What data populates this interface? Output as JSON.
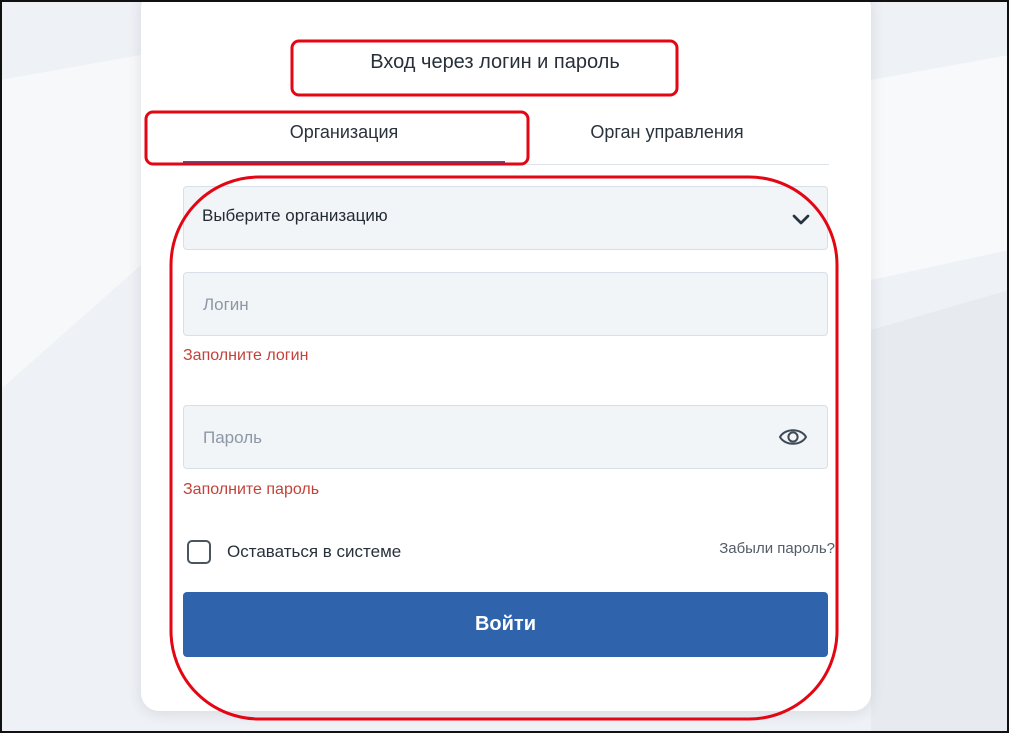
{
  "page": {
    "heading": "Вход через логин и пароль"
  },
  "tabs": [
    {
      "label": "Организация",
      "active": true
    },
    {
      "label": "Орган управления",
      "active": false
    }
  ],
  "organization": {
    "selected": "Выберите организацию",
    "icon": "chevron-down-icon"
  },
  "login": {
    "value": "",
    "placeholder": "Логин",
    "error": "Заполните логин"
  },
  "password": {
    "value": "",
    "placeholder": "Пароль",
    "error": "Заполните пароль",
    "icon": "eye-icon"
  },
  "remember": {
    "label": "Оставаться в системе",
    "checked": false
  },
  "links": {
    "forgot_password": "Забыли пароль?"
  },
  "actions": {
    "submit_label": "Войти"
  },
  "colors": {
    "accent": "#2f64ad",
    "error": "#c2423a",
    "annotation": "#e30613"
  }
}
